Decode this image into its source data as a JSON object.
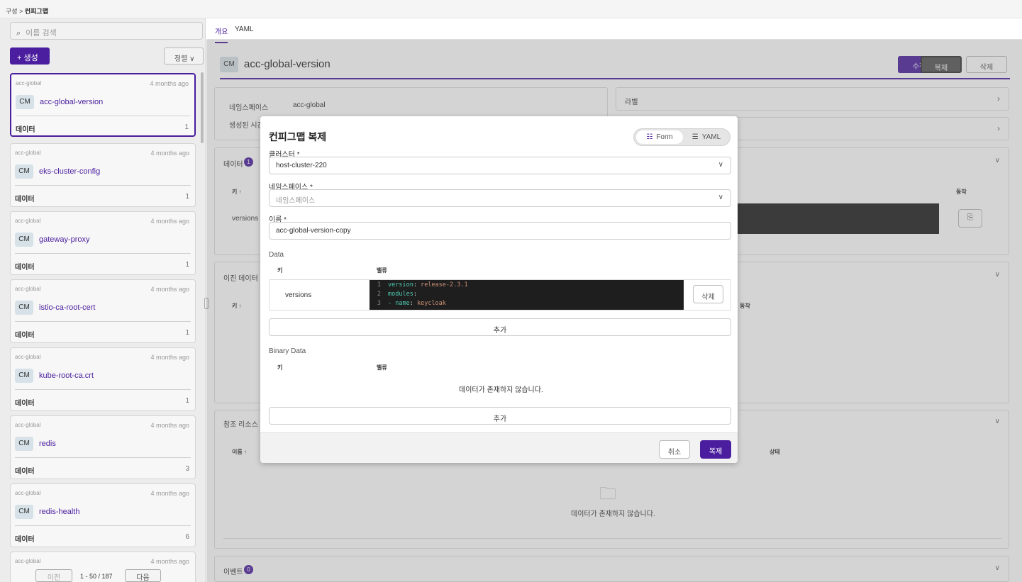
{
  "breadcrumb": {
    "parent": "구성",
    "sep": ">",
    "current": "컨피그맵"
  },
  "sidebar": {
    "search_placeholder": "이름 검색",
    "create_label": "+ 생성",
    "sort_label": "정렬 ∨",
    "cards": [
      {
        "ns": "acc-global",
        "age": "4 months ago",
        "type": "CM",
        "name": "acc-global-version",
        "data_label": "데이터",
        "data_count": "1"
      },
      {
        "ns": "acc-global",
        "age": "4 months ago",
        "type": "CM",
        "name": "eks-cluster-config",
        "data_label": "데이터",
        "data_count": "1"
      },
      {
        "ns": "acc-global",
        "age": "4 months ago",
        "type": "CM",
        "name": "gateway-proxy",
        "data_label": "데이터",
        "data_count": "1"
      },
      {
        "ns": "acc-global",
        "age": "4 months ago",
        "type": "CM",
        "name": "istio-ca-root-cert",
        "data_label": "데이터",
        "data_count": "1"
      },
      {
        "ns": "acc-global",
        "age": "4 months ago",
        "type": "CM",
        "name": "kube-root-ca.crt",
        "data_label": "데이터",
        "data_count": "1"
      },
      {
        "ns": "acc-global",
        "age": "4 months ago",
        "type": "CM",
        "name": "redis",
        "data_label": "데이터",
        "data_count": "3"
      },
      {
        "ns": "acc-global",
        "age": "4 months ago",
        "type": "CM",
        "name": "redis-health",
        "data_label": "데이터",
        "data_count": "6"
      },
      {
        "ns": "acc-global",
        "age": "4 months ago"
      }
    ],
    "pager": {
      "prev": "이전",
      "range": "1 - 50 / 187",
      "next": "다음"
    }
  },
  "main": {
    "tabs": [
      "개요",
      "YAML"
    ],
    "title_badge": "CM",
    "title": "acc-global-version",
    "actions": {
      "edit": "수정",
      "clone": "복제",
      "delete": "삭제"
    },
    "info": {
      "namespace_label": "네임스페이스",
      "namespace_value": "acc-global",
      "created_label": "생성된 시간",
      "labels_label": "라벨"
    },
    "data_section": {
      "title": "데이터",
      "count": "1",
      "key_header": "키 ↑",
      "action_header": "동작",
      "row_key": "versions"
    },
    "binary_section": {
      "title": "이진 데이터",
      "key_header": "키 ↑",
      "action_header": "동작"
    },
    "ref_section": {
      "title": "참조 리소스",
      "name_header": "이름 ↑",
      "status_header": "상태",
      "empty": "데이터가 존재하지 않습니다."
    },
    "events_section": {
      "title": "이벤트",
      "count": "0"
    }
  },
  "modal": {
    "title": "컨피그맵 복제",
    "mode_form": "Form",
    "mode_yaml": "YAML",
    "cluster_label": "클러스터 *",
    "cluster_value": "host-cluster-220",
    "namespace_label": "네임스페이스 *",
    "namespace_placeholder": "네임스페이스",
    "name_label": "이름 *",
    "name_value": "acc-global-version-copy",
    "data_title": "Data",
    "key_header": "키",
    "value_header": "밸류",
    "data_row": {
      "key": "versions",
      "code": [
        {
          "n": "1",
          "k": "version",
          "s": ": ",
          "v": "release-2.3.1"
        },
        {
          "n": "2",
          "k": "modules",
          "s": ":",
          "v": ""
        },
        {
          "n": "3",
          "k": "- name",
          "s": ": ",
          "v": "keycloak"
        }
      ],
      "delete_label": "삭제"
    },
    "add_label": "추가",
    "binary_title": "Binary Data",
    "binary_empty": "데이터가 존재하지 않습니다.",
    "cancel_label": "취소",
    "submit_label": "복제"
  },
  "colors": {
    "accent": "#4a1e9e",
    "code_bg": "#1e1e1e"
  }
}
